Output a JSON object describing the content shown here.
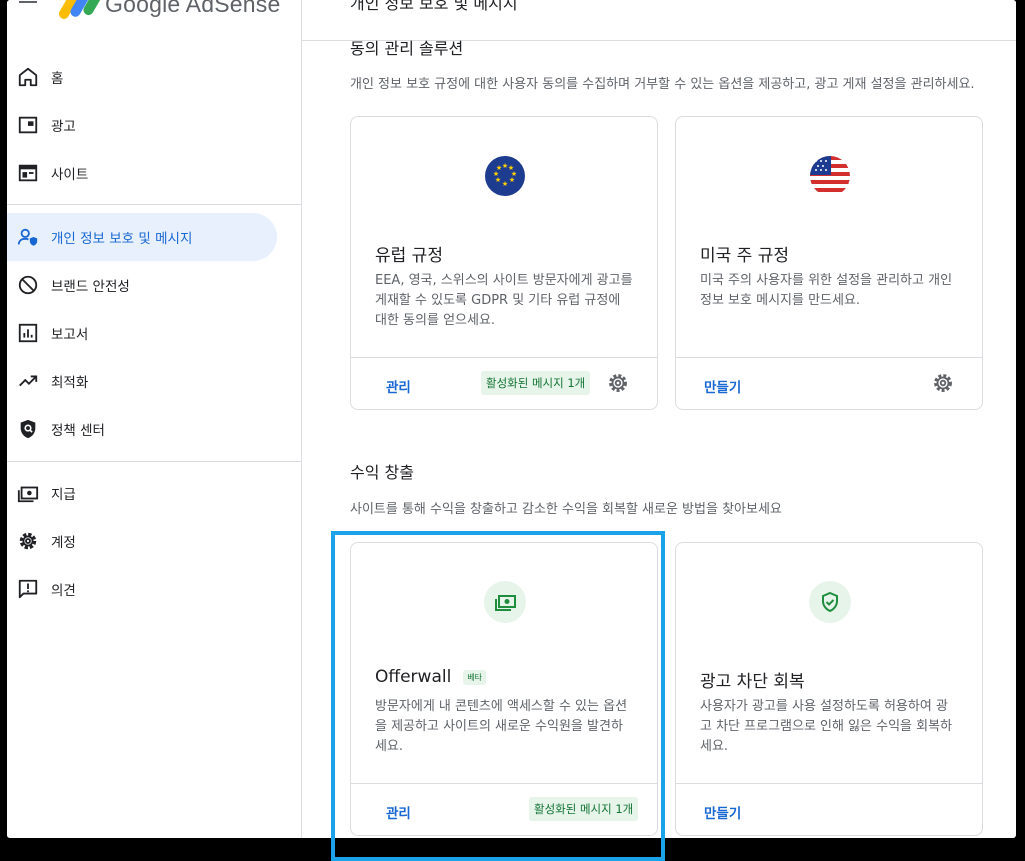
{
  "app": {
    "logo_text": "Google AdSense"
  },
  "header": {
    "page_title": "개인 정보 보호 및 메시지"
  },
  "sidebar": {
    "items": [
      {
        "label": "홈",
        "icon": "home-icon"
      },
      {
        "label": "광고",
        "icon": "ads-icon"
      },
      {
        "label": "사이트",
        "icon": "sites-icon"
      },
      {
        "label": "개인 정보 보호 및 메시지",
        "icon": "privacy-icon",
        "active": true
      },
      {
        "label": "브랜드 안전성",
        "icon": "block-icon"
      },
      {
        "label": "보고서",
        "icon": "reports-icon"
      },
      {
        "label": "최적화",
        "icon": "trending-icon"
      },
      {
        "label": "정책 센터",
        "icon": "shield-icon"
      },
      {
        "label": "지급",
        "icon": "payments-icon"
      },
      {
        "label": "계정",
        "icon": "gear-icon"
      },
      {
        "label": "의견",
        "icon": "feedback-icon"
      }
    ]
  },
  "sections": {
    "consent": {
      "title": "동의 관리 솔루션",
      "desc": "개인 정보 보호 규정에 대한 사용자 동의를 수집하며 거부할 수 있는 옵션을 제공하고, 광고 게재 설정을 관리하세요.",
      "cards": [
        {
          "title": "유럽 규정",
          "desc": "EEA, 영국, 스위스의 사이트 방문자에게 광고를 게재할 수 있도록 GDPR 및 기타 유럽 규정에 대한 동의를 얻으세요.",
          "link": "관리",
          "status": "활성화된 메시지 1개",
          "icon": "eu-flag-icon"
        },
        {
          "title": "미국 주 규정",
          "desc": "미국 주의 사용자를 위한 설정을 관리하고 개인 정보 보호 메시지를 만드세요.",
          "link": "만들기",
          "icon": "us-flag-icon"
        }
      ]
    },
    "revenue": {
      "title": "수익 창출",
      "desc": "사이트를 통해 수익을 창출하고 감소한 수익을 회복할 새로운 방법을 찾아보세요",
      "cards": [
        {
          "title": "Offerwall",
          "badge": "베타",
          "desc": "방문자에게 내 콘텐츠에 액세스할 수 있는 옵션을 제공하고 사이트의 새로운 수익원을 발견하세요.",
          "link": "관리",
          "status": "활성화된 메시지 1개",
          "icon": "money-icon"
        },
        {
          "title": "광고 차단 회복",
          "desc": "사용자가 광고를 사용 설정하도록 허용하여 광고 차단 프로그램으로 인해 잃은 수익을 회복하세요.",
          "link": "만들기",
          "icon": "shield-check-icon"
        }
      ]
    }
  },
  "colors": {
    "accent": "#1967d2",
    "active_bg": "#e8f0fe",
    "highlight": "#1aa3e8",
    "chip_bg": "#e6f4ea",
    "chip_text": "#137333"
  }
}
